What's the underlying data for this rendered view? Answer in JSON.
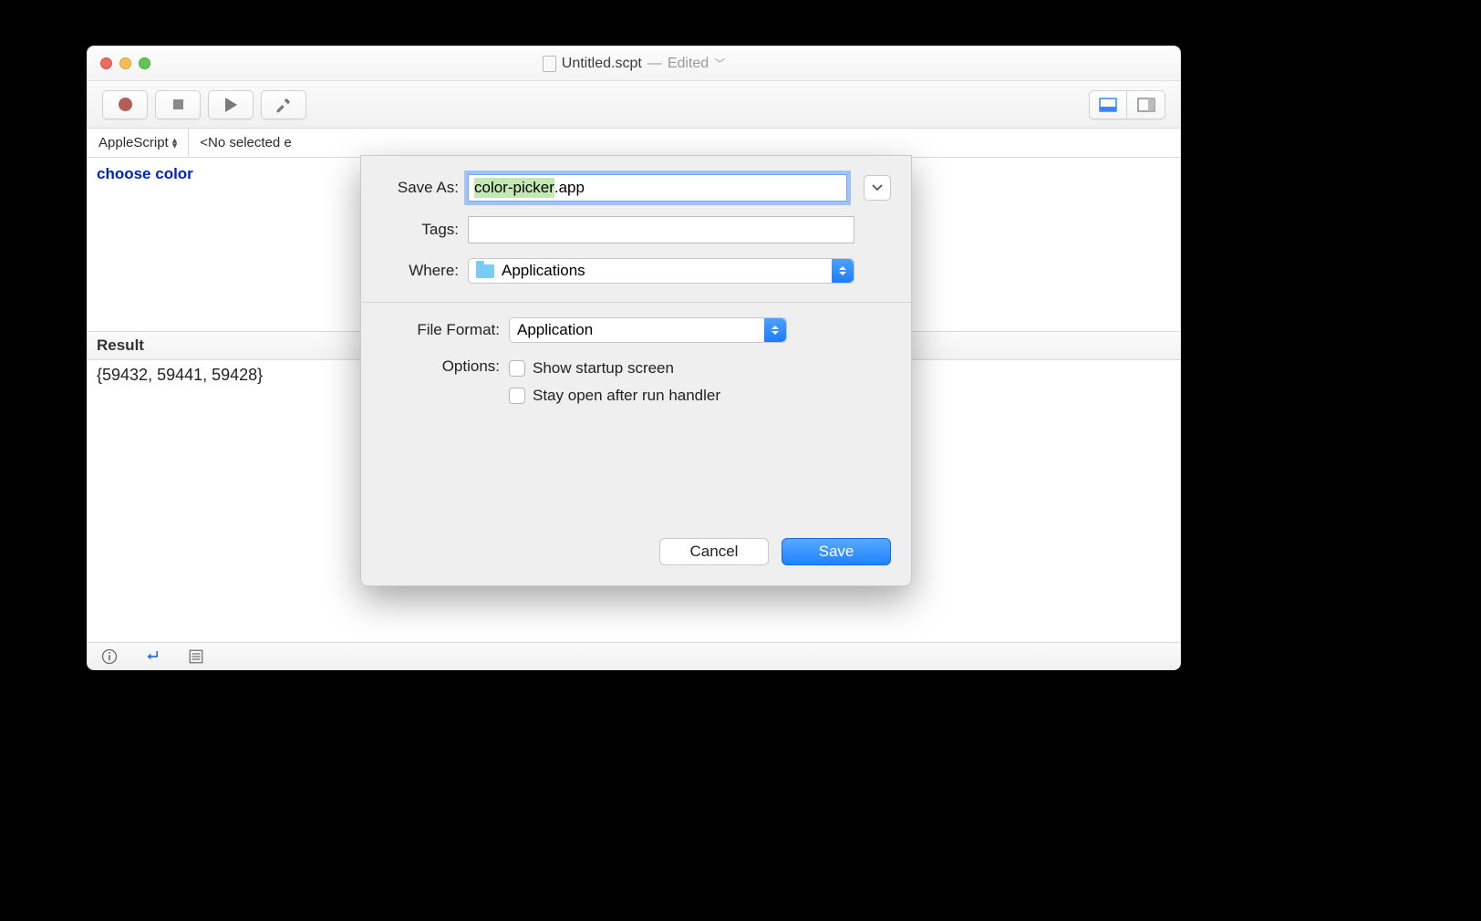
{
  "colors": {
    "close": "#ed6a5f",
    "min": "#f5bf4f",
    "zoom": "#61c554"
  },
  "title": {
    "filename": "Untitled.scpt",
    "status": "Edited"
  },
  "langbar": {
    "language": "AppleScript",
    "handler": "<No selected e"
  },
  "editor": {
    "code_keyword": "choose color"
  },
  "result": {
    "header": "Result",
    "value": "{59432, 59441, 59428}"
  },
  "sheet": {
    "save_as_label": "Save As:",
    "filename_prefix": "color-picker",
    "filename_suffix": ".app",
    "tags_label": "Tags:",
    "where_label": "Where:",
    "where_value": "Applications",
    "format_label": "File Format:",
    "format_value": "Application",
    "options_label": "Options:",
    "option1": "Show startup screen",
    "option2": "Stay open after run handler",
    "cancel": "Cancel",
    "save": "Save"
  }
}
